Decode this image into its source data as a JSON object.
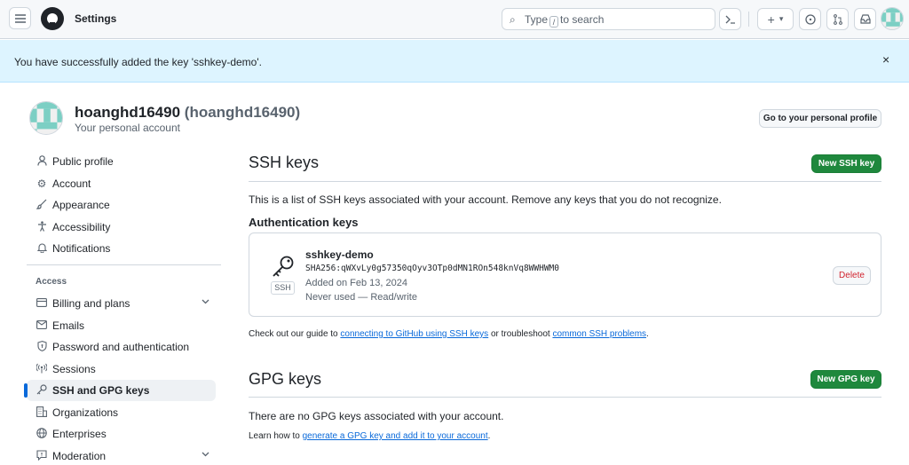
{
  "header": {
    "page_label": "Settings",
    "search": {
      "before": "Type",
      "key": "/",
      "after": "to search"
    },
    "plus_label": "+",
    "dropdown_caret": "▾"
  },
  "flash": {
    "message": "You have successfully added the key 'sshkey-demo'.",
    "close": "×"
  },
  "user": {
    "name": "hoanghd16490",
    "handle": "(hoanghd16490)",
    "subtitle": "Your personal account",
    "profile_button": "Go to your personal profile"
  },
  "sidebar": {
    "items": [
      {
        "label": "Public profile",
        "icon": "person-icon"
      },
      {
        "label": "Account",
        "icon": "gear-icon"
      },
      {
        "label": "Appearance",
        "icon": "paintbrush-icon"
      },
      {
        "label": "Accessibility",
        "icon": "accessibility-icon"
      },
      {
        "label": "Notifications",
        "icon": "bell-icon"
      }
    ],
    "section_label": "Access",
    "access_items": [
      {
        "label": "Billing and plans",
        "icon": "credit-card-icon",
        "expandable": true
      },
      {
        "label": "Emails",
        "icon": "mail-icon"
      },
      {
        "label": "Password and authentication",
        "icon": "shield-lock-icon"
      },
      {
        "label": "Sessions",
        "icon": "broadcast-icon"
      },
      {
        "label": "SSH and GPG keys",
        "icon": "key-icon",
        "active": true
      },
      {
        "label": "Organizations",
        "icon": "organization-icon"
      },
      {
        "label": "Enterprises",
        "icon": "globe-icon"
      },
      {
        "label": "Moderation",
        "icon": "report-icon",
        "expandable": true
      }
    ]
  },
  "ssh": {
    "title": "SSH keys",
    "new_button": "New SSH key",
    "description": "This is a list of SSH keys associated with your account. Remove any keys that you do not recognize.",
    "auth_heading": "Authentication keys",
    "key": {
      "name": "sshkey-demo",
      "fingerprint": "SHA256:qWXvLy0g57350qOyv3OTp0dMN1ROn548knVq8WWHWM0",
      "added": "Added on Feb 13, 2024",
      "usage": "Never used — Read/write",
      "tag": "SSH",
      "delete_button": "Delete"
    },
    "guide_prefix": "Check out our guide to",
    "guide_link1": "connecting to GitHub using SSH keys",
    "guide_middle": "or troubleshoot",
    "guide_link2": "common SSH problems",
    "guide_suffix": "."
  },
  "gpg": {
    "title": "GPG keys",
    "new_button": "New GPG key",
    "empty_text": "There are no GPG keys associated with your account.",
    "learn_prefix": "Learn how to",
    "learn_link": "generate a GPG key and add it to your account",
    "learn_suffix": "."
  },
  "colors": {
    "accent": "#0969da",
    "primary_button": "#1f883d",
    "flash_bg": "#ddf4ff",
    "danger": "#d1242f"
  }
}
